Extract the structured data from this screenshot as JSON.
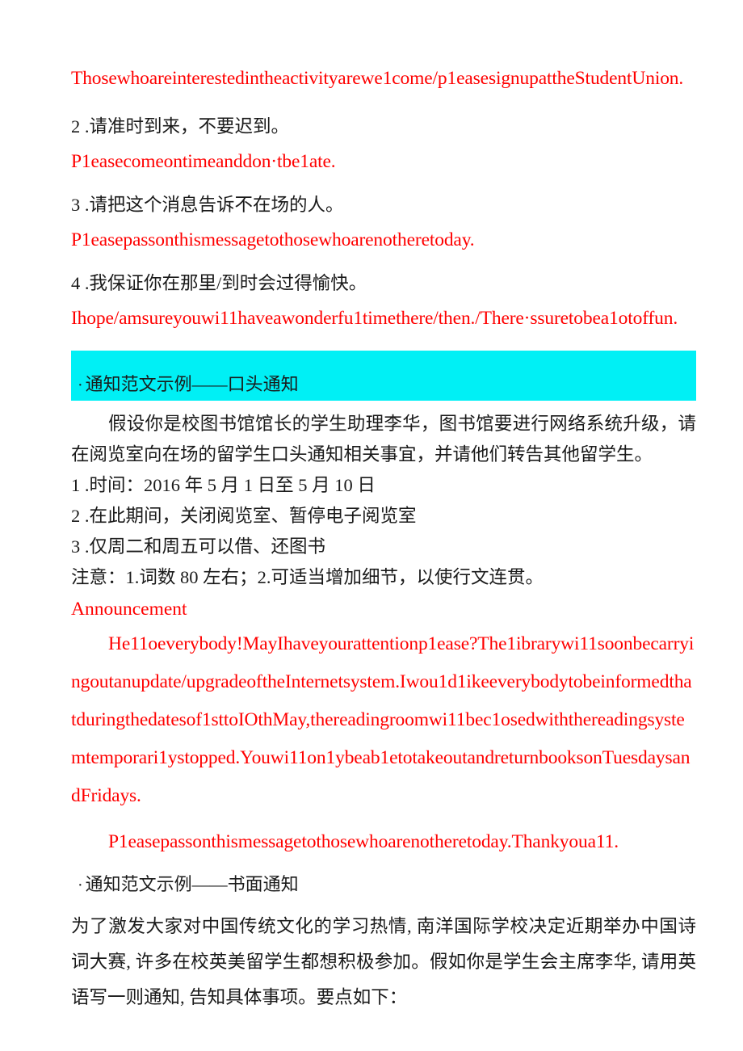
{
  "document": {
    "colors": {
      "answer_red": "#ff0000",
      "highlight_cyan": "#00f0f5",
      "body_text": "#1a1a1a",
      "page_background": "#ffffff"
    }
  },
  "top_answers": {
    "line1_english": "Thosewhoareinterestedintheactivityarewe1come/p1easesignupattheStudentUnion.",
    "item2_chinese": "2 .请准时到来，不要迟到。",
    "item2_english": "P1easecomeontimeanddon·tbe1ate.",
    "item3_chinese": "3 .请把这个消息告诉不在场的人。",
    "item3_english": "P1easepassonthismessagetothosewhoarenotheretoday.",
    "item4_chinese": "4 .我保证你在那里/到时会过得愉快。",
    "item4_english": "Ihope/amsureyouwi11haveawonderfu1timethere/then./There·ssuretobea1otoffun."
  },
  "oral_notice_section": {
    "bullet": "·",
    "heading": "通知范文示例——口头通知",
    "prompt_paragraph": "假设你是校图书馆馆长的学生助理李华，图书馆要进行网络系统升级，请在阅览室向在场的留学生口头通知相关事宜，并请他们转告其他留学生。",
    "requirements": [
      "1 .时间：2016 年 5 月 1 日至 5 月 10 日",
      "2 .在此期间，关闭阅览室、暂停电子阅览室",
      "3 .仅周二和周五可以借、还图书"
    ],
    "note_line": "注意：1.词数 80 左右；2.可适当增加细节，以使行文连贯。",
    "answer_title": "Announcement",
    "answer_body": "He11oeverybody!MayIhaveyourattentionp1ease?The1ibrarywi11soonbecarryingoutanupdate/upgradeoftheInternetsystem.Iwou1d1ikeeverybodytobeinformedthatduringthedatesof1sttoIOthMay,thereadingroomwi11bec1osedwiththereadingsystemtemporari1ystopped.Youwi11on1ybeab1etotakeoutandreturnbooksonTuesdaysandFridays.",
    "answer_closing": "P1easepassonthismessagetothosewhoarenotheretoday.Thankyoua11."
  },
  "written_notice_section": {
    "bullet": "·",
    "heading": "通知范文示例——书面通知",
    "prompt_paragraph": "为了激发大家对中国传统文化的学习热情, 南洋国际学校决定近期举办中国诗词大赛, 许多在校英美留学生都想积极参加。假如你是学生会主席李华, 请用英语写一则通知, 告知具体事项。要点如下："
  }
}
